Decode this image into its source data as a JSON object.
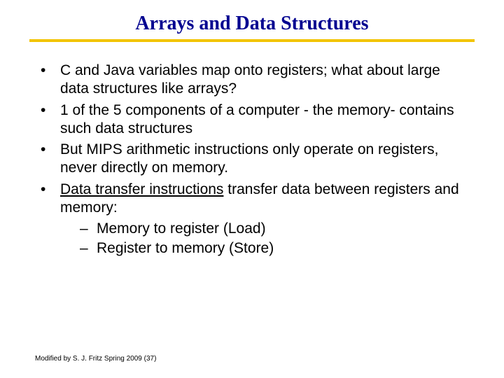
{
  "title": "Arrays and Data Structures",
  "bullets": {
    "b0": "C and Java variables map onto registers; what about large data structures like arrays?",
    "b1": "1 of the 5 components of a computer - the memory- contains such data structures",
    "b2": "But MIPS arithmetic instructions only operate on registers, never directly on memory.",
    "b3_underlined": "Data transfer instructions",
    "b3_rest": " transfer data between registers and memory:",
    "s0": "Memory to register  (Load)",
    "s1": "Register to memory (Store)"
  },
  "footer": "Modified by S. J. Fritz  Spring 2009 (37)"
}
